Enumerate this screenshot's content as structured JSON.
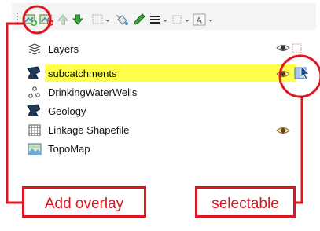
{
  "toolbar": {
    "buttons": [
      {
        "name": "add-overlay-button",
        "icon": "add-layer-icon"
      },
      {
        "name": "remove-layer-button",
        "icon": "remove-layer-icon"
      },
      {
        "name": "move-up-button",
        "icon": "arrow-up-icon"
      },
      {
        "name": "move-down-button",
        "icon": "arrow-down-icon"
      },
      {
        "name": "select-features-button",
        "icon": "select-icon"
      },
      {
        "name": "paint-bucket-button",
        "icon": "fill-icon"
      },
      {
        "name": "pencil-button",
        "icon": "pencil-icon"
      },
      {
        "name": "line-style-button",
        "icon": "line-style-icon"
      },
      {
        "name": "extent-button",
        "icon": "extent-icon"
      },
      {
        "name": "label-button",
        "icon": "label-icon",
        "text": "A"
      }
    ]
  },
  "layers_panel": {
    "header_label": "Layers",
    "layers": [
      {
        "label": "subcatchments",
        "icon": "polygon-layer-icon",
        "selected": true,
        "visible": true,
        "selectable": true
      },
      {
        "label": "DrinkingWaterWells",
        "icon": "point-layer-icon",
        "selected": false,
        "visible": false,
        "selectable": false
      },
      {
        "label": "Geology",
        "icon": "polygon-layer-icon",
        "selected": false,
        "visible": false,
        "selectable": false
      },
      {
        "label": "Linkage Shapefile",
        "icon": "grid-layer-icon",
        "selected": false,
        "visible": true,
        "selectable": false
      },
      {
        "label": "TopoMap",
        "icon": "image-layer-icon",
        "selected": false,
        "visible": false,
        "selectable": false
      }
    ]
  },
  "callouts": {
    "add_overlay": "Add overlay",
    "selectable": "selectable"
  },
  "colors": {
    "callout_red": "#e0141e",
    "selection_yellow": "#ffff4c",
    "toolbar_bg": "#f4f4f4"
  }
}
